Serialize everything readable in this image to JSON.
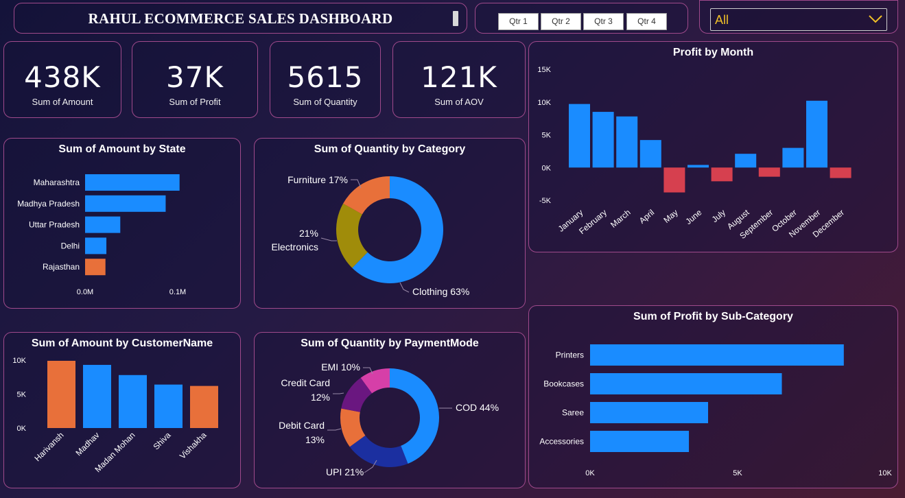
{
  "header": {
    "title": "RAHUL ECOMMERCE SALES DASHBOARD"
  },
  "quarter_slicer": {
    "buttons": [
      "Qtr 1",
      "Qtr 2",
      "Qtr 3",
      "Qtr 4"
    ]
  },
  "state_filter": {
    "value": "All"
  },
  "kpis": [
    {
      "value": "438K",
      "label": "Sum of Amount"
    },
    {
      "value": "37K",
      "label": "Sum of Profit"
    },
    {
      "value": "5615",
      "label": "Sum of Quantity"
    },
    {
      "value": "121K",
      "label": "Sum of AOV"
    }
  ],
  "colors": {
    "blue": "#1a8cff",
    "orange": "#e8703a",
    "olive": "#a08c0a",
    "red": "#d6404f",
    "navy": "#1b2fa0",
    "purple": "#6a1780",
    "pink": "#d63fa8",
    "border": "#a04a8c"
  },
  "chart_data": [
    {
      "id": "amount_by_state",
      "type": "bar",
      "orientation": "horizontal",
      "title": "Sum of Amount by State",
      "categories": [
        "Maharashtra",
        "Madhya Pradesh",
        "Uttar Pradesh",
        "Delhi",
        "Rajasthan"
      ],
      "values": [
        102000,
        87000,
        38000,
        23000,
        22000
      ],
      "highlight": [
        "blue",
        "blue",
        "blue",
        "blue",
        "orange"
      ],
      "xticks": [
        "0.0M",
        "0.1M"
      ],
      "xlim": [
        0,
        100000
      ]
    },
    {
      "id": "quantity_by_category",
      "type": "pie",
      "donut": true,
      "title": "Sum of Quantity by Category",
      "labels": [
        "Clothing",
        "Electronics",
        "Furniture"
      ],
      "values": [
        63,
        21,
        17
      ],
      "display": [
        "Clothing 63%",
        "Electronics",
        "21%",
        "Furniture 17%"
      ]
    },
    {
      "id": "profit_by_month",
      "type": "bar",
      "title": "Profit by Month",
      "categories": [
        "January",
        "February",
        "March",
        "April",
        "May",
        "June",
        "July",
        "August",
        "September",
        "October",
        "November",
        "December"
      ],
      "values": [
        9700,
        8500,
        7800,
        4200,
        -3800,
        400,
        -2100,
        2100,
        -1400,
        3000,
        10200,
        -1600
      ],
      "yticks": [
        "15K",
        "10K",
        "5K",
        "0K",
        "-5K"
      ],
      "ylim": [
        -5000,
        15000
      ]
    },
    {
      "id": "amount_by_customer",
      "type": "bar",
      "title": "Sum of Amount by CustomerName",
      "categories": [
        "Harivansh",
        "Madhav",
        "Madan Mohan",
        "Shiva",
        "Vishakha"
      ],
      "values": [
        9900,
        9300,
        7800,
        6400,
        6200
      ],
      "highlight": [
        "orange",
        "blue",
        "blue",
        "blue",
        "orange"
      ],
      "yticks": [
        "10K",
        "5K",
        "0K"
      ],
      "ylim": [
        0,
        10000
      ]
    },
    {
      "id": "quantity_by_payment",
      "type": "pie",
      "donut": true,
      "title": "Sum of Quantity by PaymentMode",
      "labels": [
        "COD",
        "UPI",
        "Debit Card",
        "Credit Card",
        "EMI"
      ],
      "values": [
        44,
        21,
        13,
        12,
        10
      ],
      "display": [
        "COD 44%",
        "UPI 21%",
        "Debit Card",
        "13%",
        "Credit Card",
        "12%",
        "EMI 10%"
      ]
    },
    {
      "id": "profit_by_subcategory",
      "type": "bar",
      "orientation": "horizontal",
      "title": "Sum of Profit by Sub-Category",
      "categories": [
        "Printers",
        "Bookcases",
        "Saree",
        "Accessories"
      ],
      "values": [
        8600,
        6500,
        4000,
        3350
      ],
      "xticks": [
        "0K",
        "5K",
        "10K"
      ],
      "xlim": [
        0,
        10000
      ]
    }
  ]
}
